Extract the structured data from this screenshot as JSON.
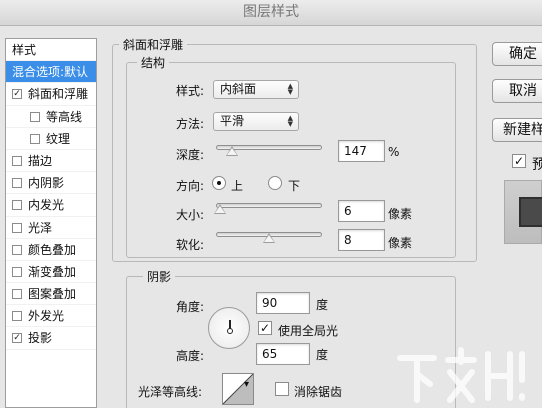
{
  "window": {
    "title": "图层样式"
  },
  "sidebar": {
    "header": "样式",
    "items": [
      {
        "label": "混合选项:默认",
        "selected": true,
        "checkbox": false,
        "checked": false,
        "level": 0
      },
      {
        "label": "斜面和浮雕",
        "selected": false,
        "checkbox": true,
        "checked": true,
        "level": 0
      },
      {
        "label": "等高线",
        "selected": false,
        "checkbox": true,
        "checked": false,
        "level": 1
      },
      {
        "label": "纹理",
        "selected": false,
        "checkbox": true,
        "checked": false,
        "level": 1
      },
      {
        "label": "描边",
        "selected": false,
        "checkbox": true,
        "checked": false,
        "level": 0
      },
      {
        "label": "内阴影",
        "selected": false,
        "checkbox": true,
        "checked": false,
        "level": 0
      },
      {
        "label": "内发光",
        "selected": false,
        "checkbox": true,
        "checked": false,
        "level": 0
      },
      {
        "label": "光泽",
        "selected": false,
        "checkbox": true,
        "checked": false,
        "level": 0
      },
      {
        "label": "颜色叠加",
        "selected": false,
        "checkbox": true,
        "checked": false,
        "level": 0
      },
      {
        "label": "渐变叠加",
        "selected": false,
        "checkbox": true,
        "checked": false,
        "level": 0
      },
      {
        "label": "图案叠加",
        "selected": false,
        "checkbox": true,
        "checked": false,
        "level": 0
      },
      {
        "label": "外发光",
        "selected": false,
        "checkbox": true,
        "checked": false,
        "level": 0
      },
      {
        "label": "投影",
        "selected": false,
        "checkbox": true,
        "checked": true,
        "level": 0
      }
    ]
  },
  "bevel": {
    "group_title": "斜面和浮雕",
    "structure_title": "结构",
    "style_label": "样式:",
    "style_value": "内斜面",
    "technique_label": "方法:",
    "technique_value": "平滑",
    "depth_label": "深度:",
    "depth_value": "147",
    "depth_unit": "%",
    "depth_slider_fraction": 0.15,
    "direction_label": "方向:",
    "direction_up": "上",
    "direction_down": "下",
    "direction_selected": "上",
    "size_label": "大小:",
    "size_value": "6",
    "size_unit": "像素",
    "size_slider_fraction": 0.04,
    "soften_label": "软化:",
    "soften_value": "8",
    "soften_unit": "像素",
    "soften_slider_fraction": 0.5
  },
  "shading": {
    "title": "阴影",
    "angle_label": "角度:",
    "angle_value": "90",
    "angle_unit": "度",
    "global_light_label": "使用全局光",
    "global_light_checked": true,
    "altitude_label": "高度:",
    "altitude_value": "65",
    "altitude_unit": "度",
    "gloss_contour_label": "光泽等高线:",
    "antialias_label": "消除锯齿",
    "antialias_checked": false
  },
  "buttons": {
    "ok": "确定",
    "cancel": "取消",
    "new_style": "新建样式...",
    "preview_label": "预览",
    "preview_checked": true
  },
  "icons": {
    "checkmark": "check-icon",
    "dropdown": "updown-arrows-icon",
    "slider_thumb": "slider-triangle-icon",
    "angle": "angle-dial-icon",
    "contour": "contour-curve-icon",
    "watermark": "xiazaiba-logo"
  },
  "watermark": {
    "text": "下载吧"
  },
  "colors": {
    "selection": "#3a8ee8",
    "panel": "#e6e6e6"
  }
}
